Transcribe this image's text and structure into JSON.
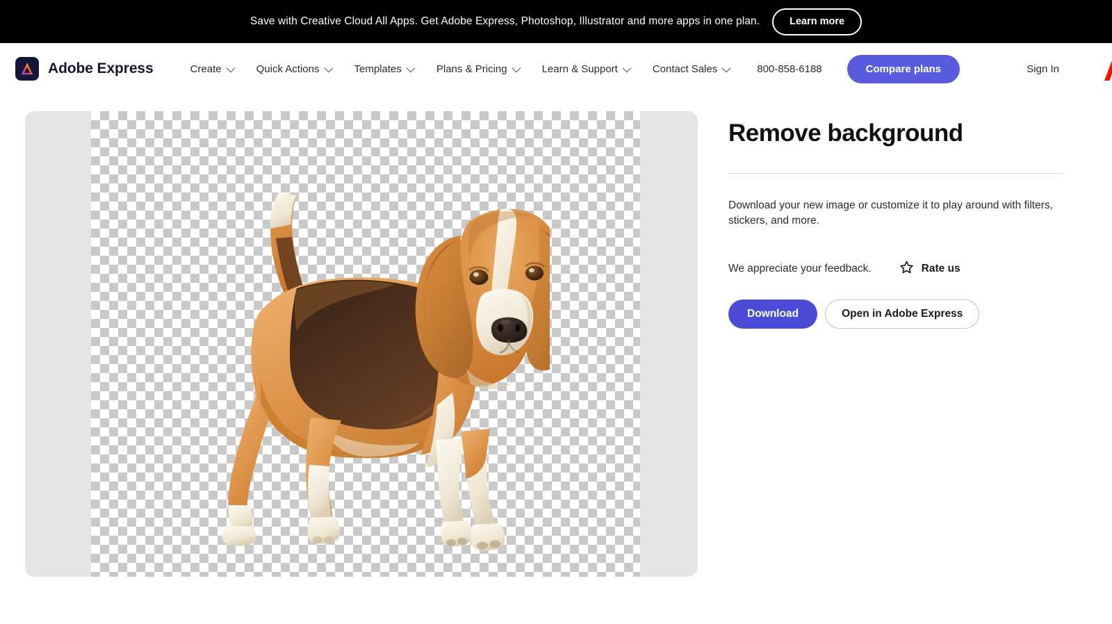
{
  "promo": {
    "text": "Save with Creative Cloud All Apps. Get Adobe Express, Photoshop, Illustrator and more apps in one plan.",
    "cta_label": "Learn more",
    "background": "#000000",
    "text_color": "#ffffff"
  },
  "nav": {
    "brand_name": "Adobe Express",
    "brand_logo_icon": "adobe-express-logo-icon",
    "items": [
      {
        "label": "Create",
        "icon": "chevron-down-icon"
      },
      {
        "label": "Quick Actions",
        "icon": "chevron-down-icon"
      },
      {
        "label": "Templates",
        "icon": "chevron-down-icon"
      },
      {
        "label": "Plans & Pricing",
        "icon": "chevron-down-icon"
      },
      {
        "label": "Learn & Support",
        "icon": "chevron-down-icon"
      },
      {
        "label": "Contact Sales",
        "icon": "chevron-down-icon"
      }
    ],
    "phone": "800-858-6188",
    "compare_plans_label": "Compare plans",
    "compare_plans_color": "#5a5ce0",
    "sign_in_label": "Sign In",
    "adobe_mark_icon": "adobe-a-logo-icon",
    "adobe_mark_color": "#fa0f00"
  },
  "canvas": {
    "frame_background": "#e5e5e5",
    "checker_light": "#ffffff",
    "checker_dark": "#c9c9c9",
    "image_subject": "beagle-dog-transparent-background",
    "image_alt_icon": "cutout-image-icon"
  },
  "panel": {
    "title": "Remove background",
    "description": "Download your new image or customize it to play around with filters, stickers, and more.",
    "feedback_label": "We appreciate your feedback.",
    "rate_us_label": "Rate us",
    "rate_us_icon": "star-outline-icon",
    "download_label": "Download",
    "download_color": "#4b4bd8",
    "open_label": "Open in Adobe Express"
  }
}
